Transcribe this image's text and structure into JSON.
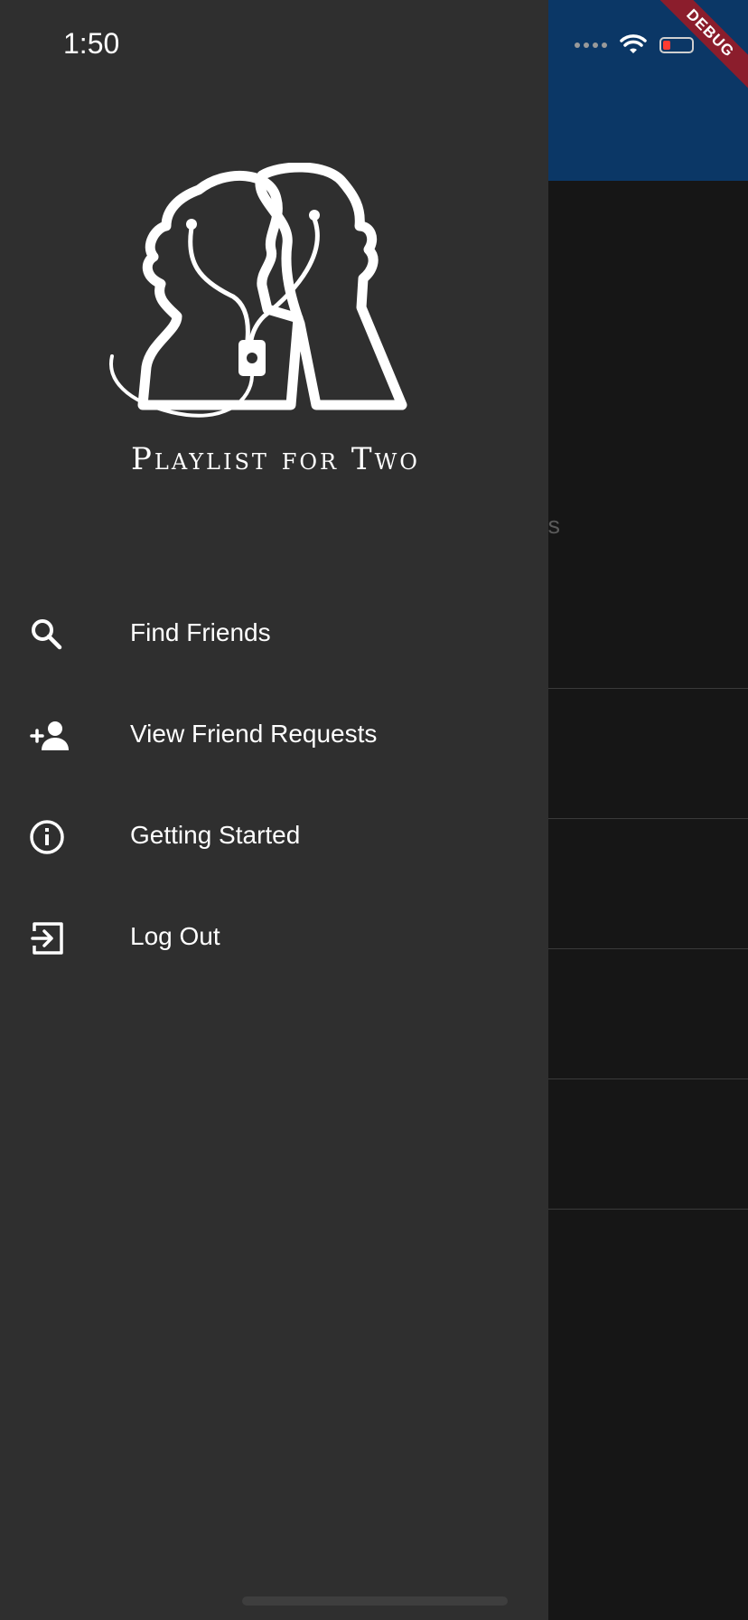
{
  "status_bar": {
    "time": "1:50"
  },
  "debug_banner": {
    "label": "DEBUG"
  },
  "background": {
    "heading_fragment": "ylists"
  },
  "drawer": {
    "logo": {
      "title": "Playlist for Two"
    },
    "menu": [
      {
        "label": "Find Friends",
        "icon": "search-icon"
      },
      {
        "label": "View Friend Requests",
        "icon": "person-add-icon"
      },
      {
        "label": "Getting Started",
        "icon": "info-icon"
      },
      {
        "label": "Log Out",
        "icon": "logout-icon"
      }
    ]
  },
  "colors": {
    "drawer_bg": "#2f2f2f",
    "app_bar": "#0b3766",
    "page_bg": "#161616",
    "debug_ribbon": "#8b1d2c"
  }
}
